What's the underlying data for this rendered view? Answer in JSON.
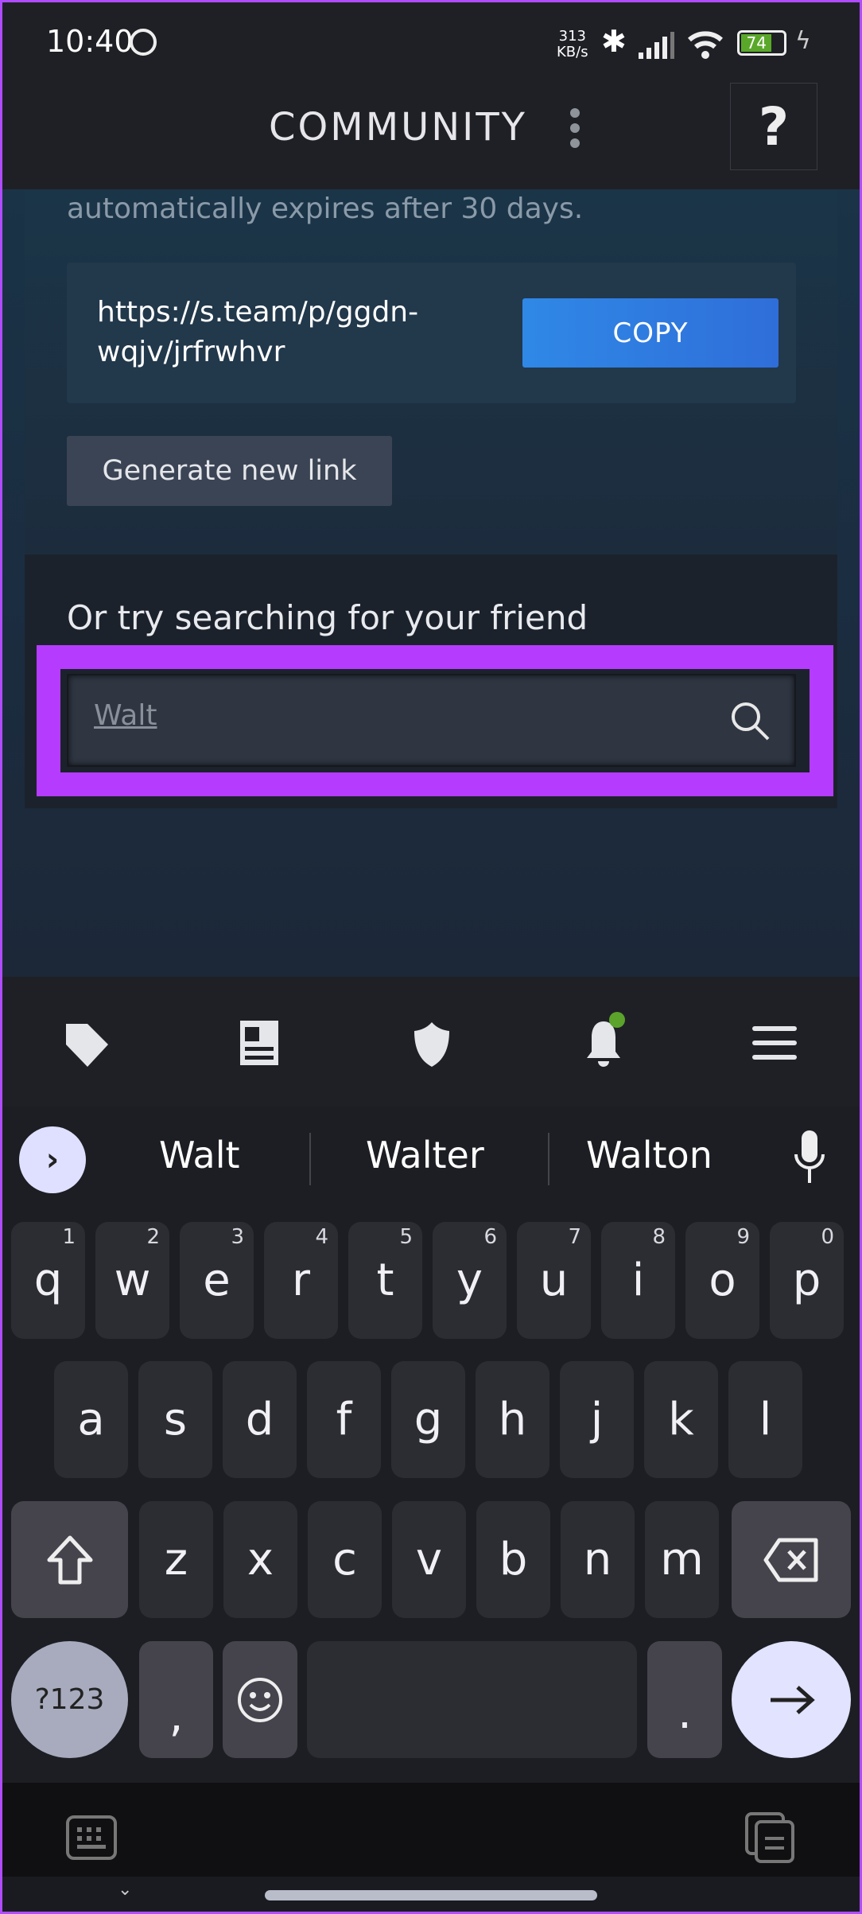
{
  "status_bar": {
    "time": "10:40",
    "net_speed_value": "313",
    "net_speed_unit": "KB/s",
    "battery": "74",
    "icons": [
      "whatsapp-icon",
      "bluetooth-icon",
      "signal-icon",
      "wifi-icon",
      "battery-icon",
      "charging-icon"
    ]
  },
  "header": {
    "title": "COMMUNITY",
    "help": "?"
  },
  "invite": {
    "expiry_text": "automatically expires after 30 days.",
    "link_line1": "https://s.team/p/ggdn-",
    "link_line2": "wqjv/jrfrwhvr",
    "copy_label": "COPY",
    "generate_label": "Generate new link"
  },
  "search": {
    "heading": "Or try searching for your friend",
    "value": "Walt",
    "highlight_color": "#b53cff"
  },
  "bottom_nav": {
    "items": [
      "tag-icon",
      "news-icon",
      "shield-icon",
      "bell-icon",
      "menu-icon"
    ],
    "notification_color": "#5ba32b"
  },
  "keyboard": {
    "suggestions": [
      "Walt",
      "Walter",
      "Walton"
    ],
    "row1": [
      "q",
      "w",
      "e",
      "r",
      "t",
      "y",
      "u",
      "i",
      "o",
      "p"
    ],
    "row1_nums": [
      "1",
      "2",
      "3",
      "4",
      "5",
      "6",
      "7",
      "8",
      "9",
      "0"
    ],
    "row2": [
      "a",
      "s",
      "d",
      "f",
      "g",
      "h",
      "j",
      "k",
      "l"
    ],
    "row3": [
      "z",
      "x",
      "c",
      "v",
      "b",
      "n",
      "m"
    ],
    "symbols_label": "?123",
    "comma": ",",
    "period": "."
  },
  "colors": {
    "accent_blue": "#2f7fe0",
    "keyboard_bg": "#1d1e23",
    "key_bg": "#2c2d33"
  }
}
